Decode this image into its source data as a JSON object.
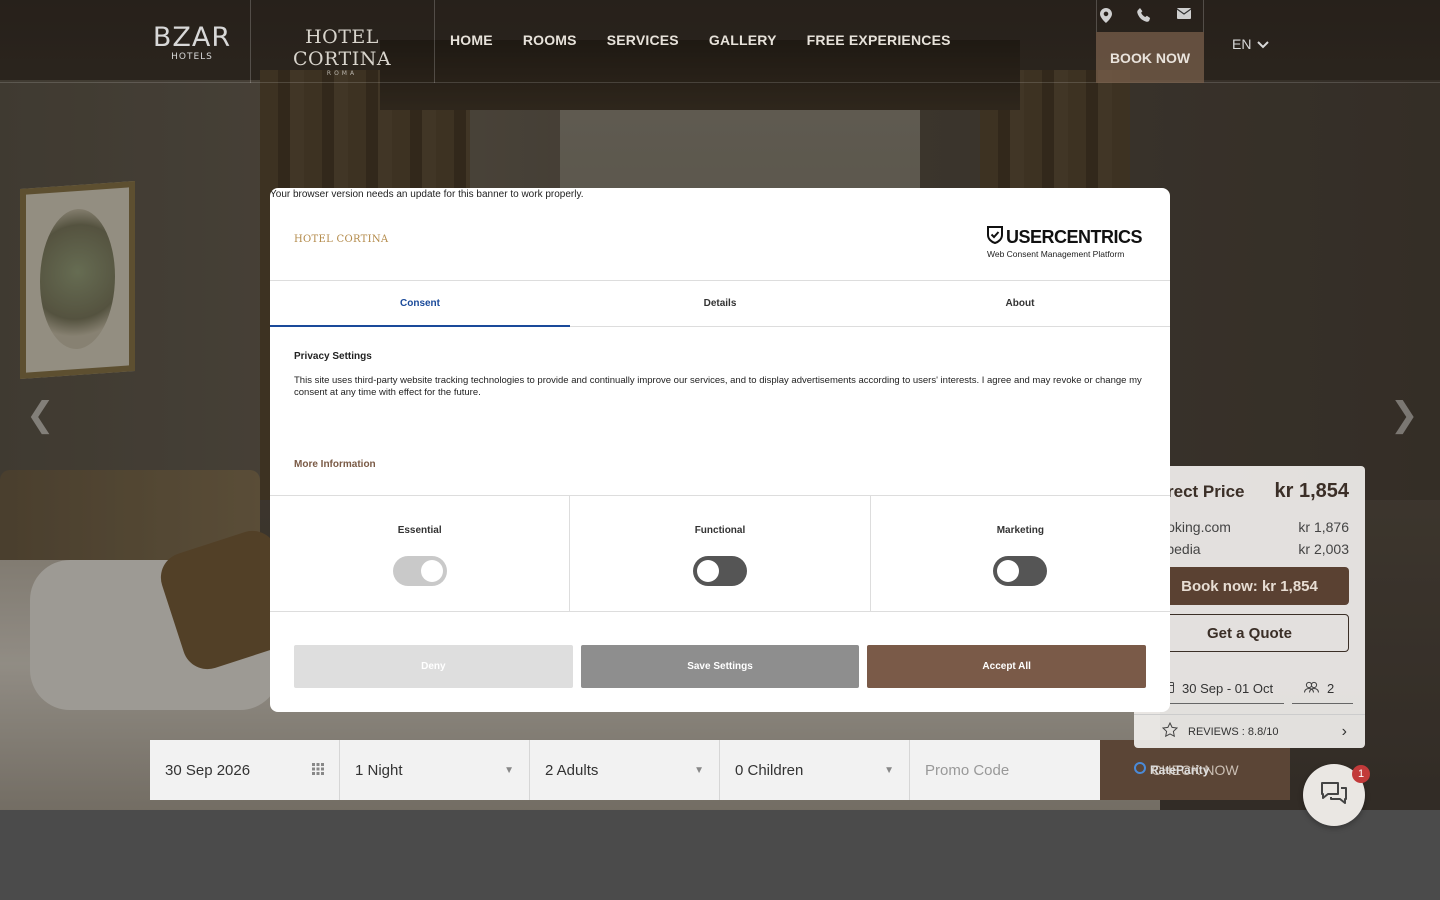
{
  "header": {
    "brand_main": "BZAR",
    "brand_sub": "HOTELS",
    "hotel_name": "HOTEL CORTINA",
    "hotel_sub": "ROMA",
    "nav": [
      {
        "label": "HOME"
      },
      {
        "label": "ROOMS"
      },
      {
        "label": "SERVICES"
      },
      {
        "label": "GALLERY"
      },
      {
        "label": "FREE EXPERIENCES"
      }
    ],
    "icons": [
      "map-pin-icon",
      "phone-icon",
      "mail-icon"
    ],
    "book_now": "BOOK NOW",
    "language": "EN"
  },
  "booking_bar": {
    "date": "30 Sep 2026",
    "nights": "1 Night",
    "adults": "2 Adults",
    "children": "0 Children",
    "promo_placeholder": "Promo Code",
    "check_now": "CHECK NOW"
  },
  "rate_parity": {
    "direct_label": "Direct Price",
    "direct_price": "kr 1,854",
    "competitors": [
      {
        "name": "Booking.com",
        "price": "kr 1,876"
      },
      {
        "name": "Expedia",
        "price": "kr 2,003"
      }
    ],
    "book_button": "Book now: kr 1,854",
    "quote_button": "Get a Quote",
    "dates": "30 Sep - 01 Oct",
    "guests": "2",
    "reviews": "REVIEWS : 8.8/10",
    "brand": "RateParity"
  },
  "chat": {
    "badge": "1"
  },
  "consent": {
    "warning": "Your browser version needs an update for this banner to work properly.",
    "hotel_logo": "HOTEL CORTINA",
    "provider_title": "USERCENTRICS",
    "provider_sub": "Web Consent Management Platform",
    "tabs": [
      {
        "label": "Consent",
        "active": true
      },
      {
        "label": "Details",
        "active": false
      },
      {
        "label": "About",
        "active": false
      }
    ],
    "privacy_title": "Privacy Settings",
    "privacy_text": "This site uses third-party website tracking technologies to provide and continually improve our services, and to display advertisements according to users' interests. I agree and may revoke or change my consent at any time with effect for the future.",
    "more_info": "More Information",
    "categories": [
      {
        "label": "Essential",
        "enabled": true
      },
      {
        "label": "Functional",
        "enabled": false
      },
      {
        "label": "Marketing",
        "enabled": false
      }
    ],
    "buttons": {
      "deny": "Deny",
      "save": "Save Settings",
      "accept": "Accept All"
    },
    "colors": {
      "active_tab": "#1a4a9a",
      "accept": "#7a5a48",
      "more_info": "#7a5a45"
    }
  }
}
